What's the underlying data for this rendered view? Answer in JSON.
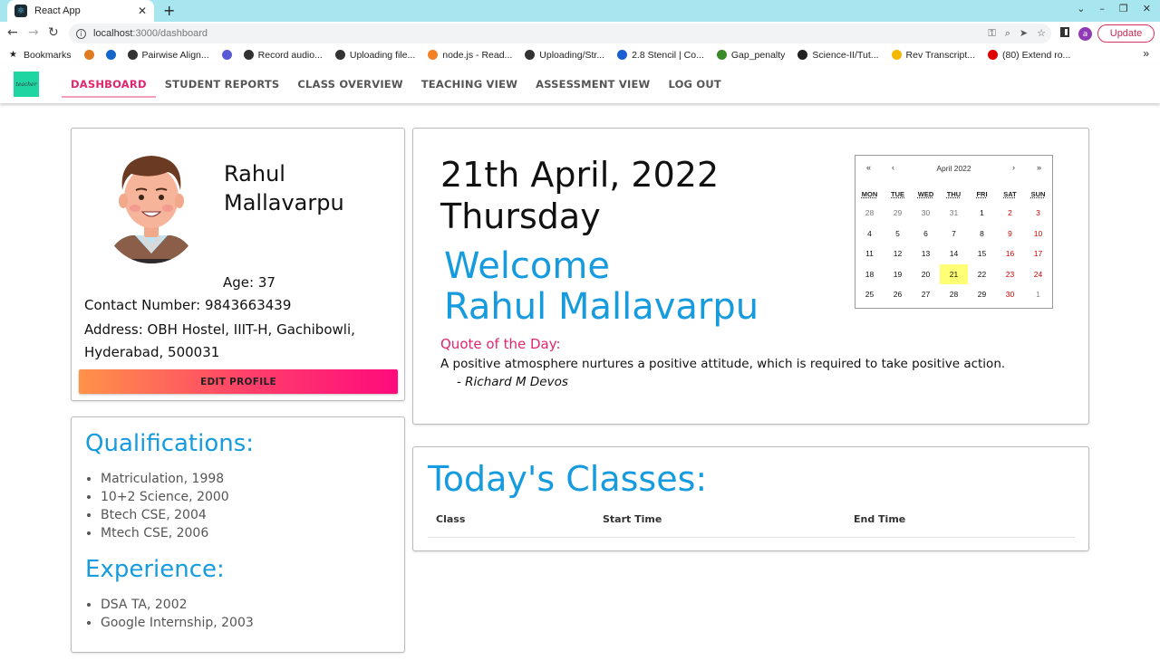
{
  "browser": {
    "tab_title": "React App",
    "url_host": "localhost",
    "url_path": ":3000/dashboard",
    "update_label": "Update",
    "profile_initial": "a",
    "bookmarks": [
      {
        "label": "Bookmarks",
        "color": "#222222"
      },
      {
        "label": "",
        "color": "#e07b1f"
      },
      {
        "label": "",
        "color": "#1466c8"
      },
      {
        "label": "Pairwise Align...",
        "color": "#333333"
      },
      {
        "label": "",
        "color": "#5a5ad6"
      },
      {
        "label": "Record audio...",
        "color": "#333333"
      },
      {
        "label": "Uploading file...",
        "color": "#333333"
      },
      {
        "label": "node.js - Read...",
        "color": "#f48024"
      },
      {
        "label": "Uploading/Str...",
        "color": "#333333"
      },
      {
        "label": "2.8 Stencil | Co...",
        "color": "#1a5fd1"
      },
      {
        "label": "Gap_penalty",
        "color": "#3a8a2a"
      },
      {
        "label": "Science-II/Tut...",
        "color": "#222222"
      },
      {
        "label": "Rev Transcript...",
        "color": "#f5b800"
      },
      {
        "label": "(80) Extend ro...",
        "color": "#e00000"
      }
    ]
  },
  "nav": {
    "logo_text": "teacher",
    "links": [
      "DASHBOARD",
      "STUDENT REPORTS",
      "CLASS OVERVIEW",
      "TEACHING VIEW",
      "ASSESSMENT VIEW",
      "LOG OUT"
    ]
  },
  "profile": {
    "name_first": "Rahul",
    "name_last": "Mallavarpu",
    "age": "Age: 37",
    "contact": "Contact Number: 9843663439",
    "address": "Address: OBH Hostel, IIIT-H, Gachibowli, Hyderabad, 500031",
    "edit_label": "EDIT PROFILE"
  },
  "qualifications": {
    "title": "Qualifications:",
    "items": [
      "Matriculation, 1998",
      "10+2 Science, 2000",
      "Btech CSE, 2004",
      "Mtech CSE, 2006"
    ]
  },
  "experience": {
    "title": "Experience:",
    "items": [
      "DSA TA, 2002",
      "Google Internship, 2003"
    ]
  },
  "today": {
    "date": "21th April, 2022",
    "weekday": "Thursday",
    "welcome": "Welcome",
    "welcome_name": "Rahul Mallavarpu",
    "quote_title": "Quote of the Day:",
    "quote": "A positive atmosphere nurtures a positive attitude, which is required to take positive action.",
    "quote_author": "- Richard M Devos"
  },
  "calendar": {
    "title": "April 2022",
    "nav": [
      "«",
      "‹",
      "›",
      "»"
    ],
    "weekdays": [
      "MON",
      "TUE",
      "WED",
      "THU",
      "FRI",
      "SAT",
      "SUN"
    ],
    "days": [
      "28",
      "29",
      "30",
      "31",
      "1",
      "2",
      "3",
      "4",
      "5",
      "6",
      "7",
      "8",
      "9",
      "10",
      "11",
      "12",
      "13",
      "14",
      "15",
      "16",
      "17",
      "18",
      "19",
      "20",
      "21",
      "22",
      "23",
      "24",
      "25",
      "26",
      "27",
      "28",
      "29",
      "30",
      "1"
    ],
    "today": "21"
  },
  "classes": {
    "title": "Today's Classes:",
    "columns": [
      "Class",
      "Start Time",
      "End Time"
    ]
  }
}
